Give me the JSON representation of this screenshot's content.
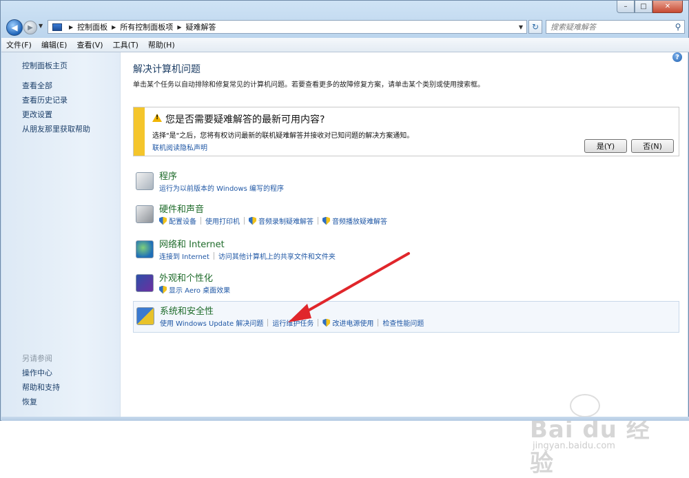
{
  "window": {
    "caption": {
      "minimize": "–",
      "maximize": "□",
      "close": "✕"
    }
  },
  "address": {
    "crumbs": [
      "控制面板",
      "所有控制面板项",
      "疑难解答"
    ],
    "search_placeholder": "搜索疑难解答"
  },
  "menu": [
    "文件(F)",
    "编辑(E)",
    "查看(V)",
    "工具(T)",
    "帮助(H)"
  ],
  "sidebar": {
    "home": "控制面板主页",
    "links": [
      "查看全部",
      "查看历史记录",
      "更改设置",
      "从朋友那里获取帮助"
    ],
    "see_also_heading": "另请参阅",
    "see_also": [
      "操作中心",
      "帮助和支持",
      "恢复"
    ]
  },
  "main": {
    "title": "解决计算机问题",
    "description": "单击某个任务以自动排除和修复常见的计算机问题。若要查看更多的故障修复方案，请单击某个类别或使用搜索框。",
    "notice": {
      "title": "您是否需要疑难解答的最新可用内容?",
      "text": "选择\"是\"之后，您将有权访问最新的联机疑难解答并接收对已知问题的解决方案通知。",
      "privacy_link": "联机阅读隐私声明",
      "yes": "是(Y)",
      "no": "否(N)"
    },
    "categories": [
      {
        "title": "程序",
        "links": [
          {
            "label": "运行为以前版本的 Windows 编写的程序",
            "shield": false
          }
        ]
      },
      {
        "title": "硬件和声音",
        "links": [
          {
            "label": "配置设备",
            "shield": true
          },
          {
            "label": "使用打印机",
            "shield": false
          },
          {
            "label": "音频录制疑难解答",
            "shield": true
          },
          {
            "label": "音频播放疑难解答",
            "shield": true
          }
        ]
      },
      {
        "title": "网络和 Internet",
        "links": [
          {
            "label": "连接到 Internet",
            "shield": false
          },
          {
            "label": "访问其他计算机上的共享文件和文件夹",
            "shield": false
          }
        ]
      },
      {
        "title": "外观和个性化",
        "links": [
          {
            "label": "显示 Aero 桌面效果",
            "shield": true
          }
        ]
      },
      {
        "title": "系统和安全性",
        "links": [
          {
            "label": "使用 Windows Update 解决问题",
            "shield": false
          },
          {
            "label": "运行维护任务",
            "shield": false
          },
          {
            "label": "改进电源使用",
            "shield": true
          },
          {
            "label": "检查性能问题",
            "shield": false
          }
        ]
      }
    ]
  },
  "watermark": {
    "brand": "Bai du 经验",
    "url": "jingyan.baidu.com"
  },
  "colors": {
    "accent_link": "#1f57a5",
    "category_title": "#1e6b2a",
    "notice_bar": "#f4c52b",
    "annotation_arrow": "#e0262b"
  }
}
